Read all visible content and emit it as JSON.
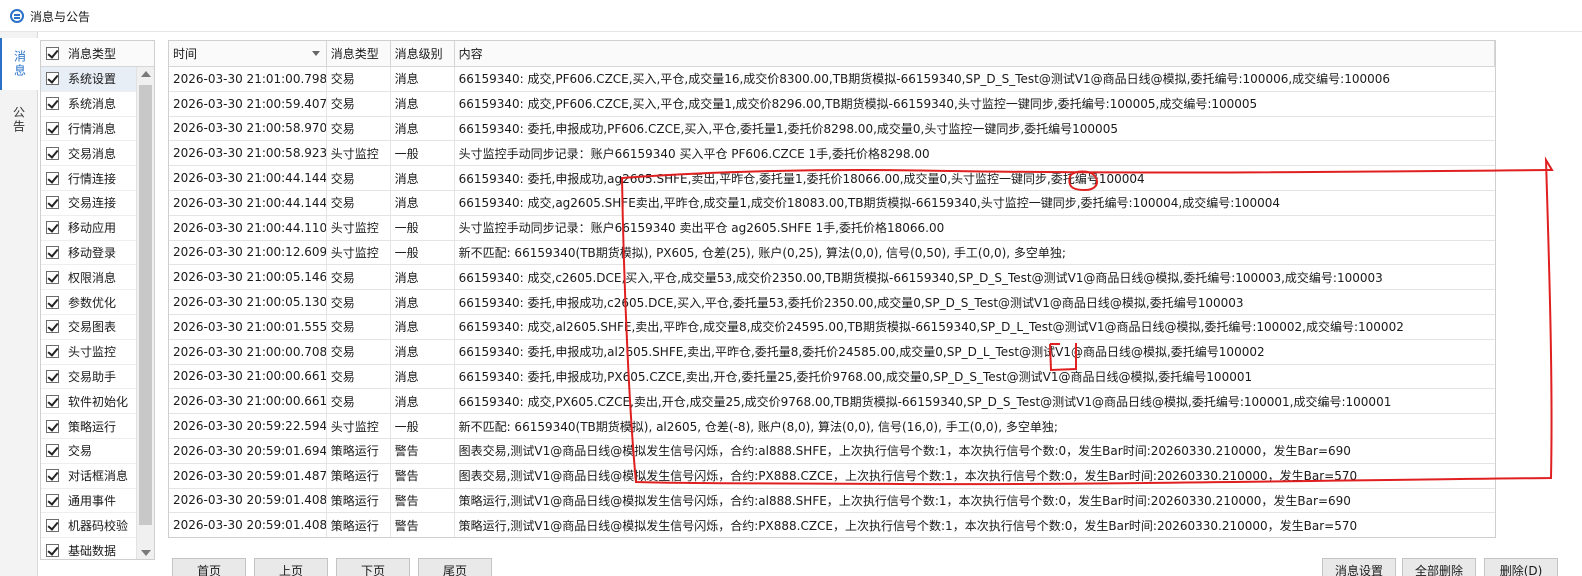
{
  "window": {
    "title": "消息与公告"
  },
  "side_tabs": [
    "消息",
    "公告"
  ],
  "left_panel": {
    "header": "消息类型",
    "items": [
      "系统设置",
      "系统消息",
      "行情消息",
      "交易消息",
      "行情连接",
      "交易连接",
      "移动应用",
      "移动登录",
      "权限消息",
      "参数优化",
      "交易图表",
      "头寸监控",
      "交易助手",
      "软件初始化",
      "策略运行",
      "交易",
      "对话框消息",
      "通用事件",
      "机器码校验",
      "基础数据"
    ]
  },
  "table": {
    "headers": {
      "time": "时间",
      "type": "消息类型",
      "level": "消息级别",
      "content": "内容"
    },
    "rows": [
      {
        "time": "2026-03-30 21:01:00.798",
        "type": "交易",
        "level": "消息",
        "content": "66159340: 成交,PF606.CZCE,买入,平仓,成交量16,成交价8300.00,TB期货模拟-66159340,SP_D_S_Test@测试V1@商品日线@模拟,委托编号:100006,成交编号:100006"
      },
      {
        "time": "2026-03-30 21:00:59.407",
        "type": "交易",
        "level": "消息",
        "content": "66159340: 成交,PF606.CZCE,买入,平仓,成交量1,成交价8296.00,TB期货模拟-66159340,头寸监控一键同步,委托编号:100005,成交编号:100005"
      },
      {
        "time": "2026-03-30 21:00:58.970",
        "type": "交易",
        "level": "消息",
        "content": "66159340: 委托,申报成功,PF606.CZCE,买入,平仓,委托量1,委托价8298.00,成交量0,头寸监控一键同步,委托编号100005"
      },
      {
        "time": "2026-03-30 21:00:58.923",
        "type": "头寸监控",
        "level": "一般",
        "content": "头寸监控手动同步记录：账户66159340 买入平仓 PF606.CZCE 1手,委托价格8298.00"
      },
      {
        "time": "2026-03-30 21:00:44.144",
        "type": "交易",
        "level": "消息",
        "content": "66159340: 委托,申报成功,ag2605.SHFE,卖出,平昨仓,委托量1,委托价18066.00,成交量0,头寸监控一键同步,委托编号100004"
      },
      {
        "time": "2026-03-30 21:00:44.144",
        "type": "交易",
        "level": "消息",
        "content": "66159340: 成交,ag2605.SHFE卖出,平昨仓,成交量1,成交价18083.00,TB期货模拟-66159340,头寸监控一键同步,委托编号:100004,成交编号:100004"
      },
      {
        "time": "2026-03-30 21:00:44.110",
        "type": "头寸监控",
        "level": "一般",
        "content": "头寸监控手动同步记录：账户66159340 卖出平仓 ag2605.SHFE 1手,委托价格18066.00"
      },
      {
        "time": "2026-03-30 21:00:12.609",
        "type": "头寸监控",
        "level": "一般",
        "content": "新不匹配: 66159340(TB期货模拟), PX605, 仓差(25), 账户(0,25), 算法(0,0), 信号(0,50), 手工(0,0), 多空单独;"
      },
      {
        "time": "2026-03-30 21:00:05.146",
        "type": "交易",
        "level": "消息",
        "content": "66159340: 成交,c2605.DCE,买入,平仓,成交量53,成交价2350.00,TB期货模拟-66159340,SP_D_S_Test@测试V1@商品日线@模拟,委托编号:100003,成交编号:100003"
      },
      {
        "time": "2026-03-30 21:00:05.130",
        "type": "交易",
        "level": "消息",
        "content": "66159340: 委托,申报成功,c2605.DCE,买入,平仓,委托量53,委托价2350.00,成交量0,SP_D_S_Test@测试V1@商品日线@模拟,委托编号100003"
      },
      {
        "time": "2026-03-30 21:00:01.555",
        "type": "交易",
        "level": "消息",
        "content": "66159340: 成交,al2605.SHFE,卖出,平昨仓,成交量8,成交价24595.00,TB期货模拟-66159340,SP_D_L_Test@测试V1@商品日线@模拟,委托编号:100002,成交编号:100002"
      },
      {
        "time": "2026-03-30 21:00:00.708",
        "type": "交易",
        "level": "消息",
        "content": "66159340: 委托,申报成功,al2605.SHFE,卖出,平昨仓,委托量8,委托价24585.00,成交量0,SP_D_L_Test@测试V1@商品日线@模拟,委托编号100002"
      },
      {
        "time": "2026-03-30 21:00:00.661",
        "type": "交易",
        "level": "消息",
        "content": "66159340: 委托,申报成功,PX605.CZCE,卖出,开仓,委托量25,委托价9768.00,成交量0,SP_D_S_Test@测试V1@商品日线@模拟,委托编号100001"
      },
      {
        "time": "2026-03-30 21:00:00.661",
        "type": "交易",
        "level": "消息",
        "content": "66159340: 成交,PX605.CZCE,卖出,开仓,成交量25,成交价9768.00,TB期货模拟-66159340,SP_D_S_Test@测试V1@商品日线@模拟,委托编号:100001,成交编号:100001"
      },
      {
        "time": "2026-03-30 20:59:22.594",
        "type": "头寸监控",
        "level": "一般",
        "content": "新不匹配: 66159340(TB期货模拟), al2605, 仓差(-8), 账户(8,0), 算法(0,0), 信号(16,0), 手工(0,0), 多空单独;"
      },
      {
        "time": "2026-03-30 20:59:01.694",
        "type": "策略运行",
        "level": "警告",
        "content": "图表交易,测试V1@商品日线@模拟发生信号闪烁，合约:al888.SHFE，上次执行信号个数:1，本次执行信号个数:0，发生Bar时间:20260330.210000，发生Bar=690"
      },
      {
        "time": "2026-03-30 20:59:01.487",
        "type": "策略运行",
        "level": "警告",
        "content": "图表交易,测试V1@商品日线@模拟发生信号闪烁，合约:PX888.CZCE，上次执行信号个数:1，本次执行信号个数:0，发生Bar时间:20260330.210000，发生Bar=570"
      },
      {
        "time": "2026-03-30 20:59:01.408",
        "type": "策略运行",
        "level": "警告",
        "content": "策略运行,测试V1@商品日线@模拟发生信号闪烁，合约:al888.SHFE，上次执行信号个数:1，本次执行信号个数:0，发生Bar时间:20260330.210000，发生Bar=690"
      },
      {
        "time": "2026-03-30 20:59:01.408",
        "type": "策略运行",
        "level": "警告",
        "content": "策略运行,测试V1@商品日线@模拟发生信号闪烁，合约:PX888.CZCE，上次执行信号个数:1，本次执行信号个数:0，发生Bar时间:20260330.210000，发生Bar=570"
      }
    ]
  },
  "buttons": {
    "first": "首页",
    "prev": "上页",
    "next": "下页",
    "last": "尾页",
    "settings": "消息设置",
    "delete_all": "全部删除",
    "delete": "删除(D)"
  },
  "annotation_color": "#e02020"
}
